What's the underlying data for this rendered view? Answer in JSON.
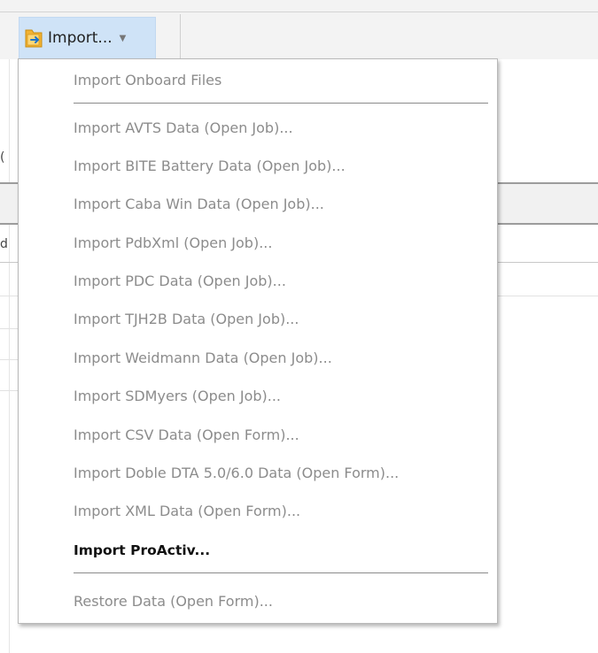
{
  "toolbar": {
    "import_label": "Import...",
    "import_icon": "folder-import-icon",
    "caret_icon": "chevron-down-icon",
    "accent_color": "#cfe3f7"
  },
  "menu": {
    "items": [
      {
        "label": "Import Onboard Files",
        "enabled": false
      },
      {
        "label": "Import AVTS Data (Open Job)...",
        "enabled": false
      },
      {
        "label": "Import BITE Battery Data (Open Job)...",
        "enabled": false
      },
      {
        "label": "Import Caba Win Data (Open Job)...",
        "enabled": false
      },
      {
        "label": "Import PdbXml (Open Job)...",
        "enabled": false
      },
      {
        "label": "Import PDC Data (Open Job)...",
        "enabled": false
      },
      {
        "label": "Import TJH2B Data (Open Job)...",
        "enabled": false
      },
      {
        "label": "Import Weidmann Data (Open Job)...",
        "enabled": false
      },
      {
        "label": "Import SDMyers (Open Job)...",
        "enabled": false
      },
      {
        "label": "Import CSV Data (Open Form)...",
        "enabled": false
      },
      {
        "label": "Import Doble DTA 5.0/6.0 Data (Open Form)...",
        "enabled": false
      },
      {
        "label": "Import XML Data (Open Form)...",
        "enabled": false
      },
      {
        "label": "Import ProActiv...",
        "enabled": true
      },
      {
        "label": "Restore Data (Open Form)...",
        "enabled": false
      }
    ],
    "disabled_color": "#8c8c8c",
    "enabled_color": "#111111"
  }
}
